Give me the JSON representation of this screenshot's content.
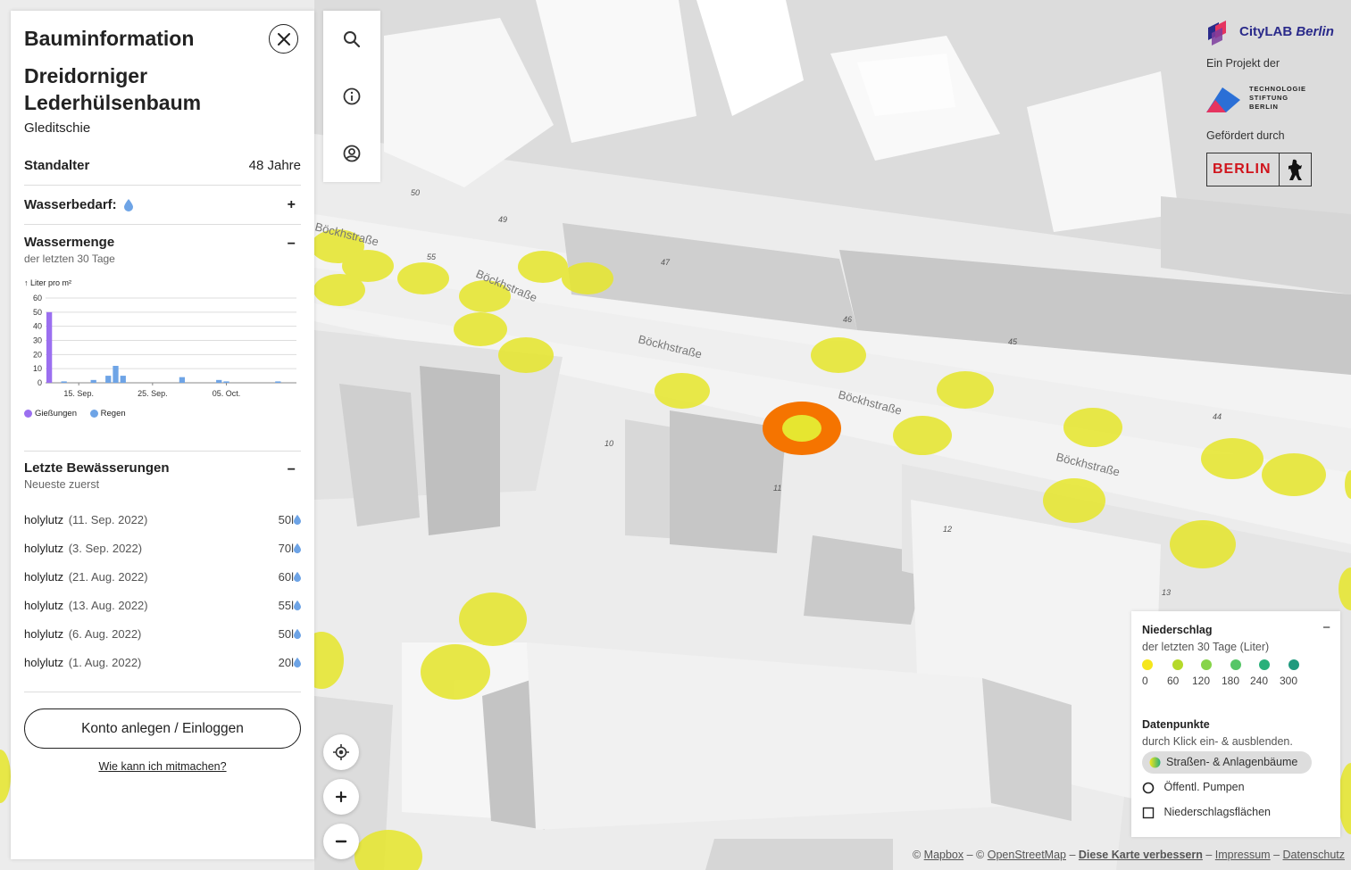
{
  "sidebar": {
    "title": "Bauminformation",
    "tree_name": "Dreidorniger Lederhülsenbaum",
    "tree_genus": "Gleditschie",
    "age_label": "Standalter",
    "age_value": "48 Jahre",
    "water_need_label": "Wasserbedarf:",
    "water_need_toggle": "+",
    "water_amount_label": "Wassermenge",
    "water_amount_sub": "der letzten 30 Tage",
    "water_amount_toggle": "−",
    "last_watering_label": "Letzte Bewässerungen",
    "last_watering_sub": "Neueste zuerst",
    "last_watering_toggle": "−",
    "waterings": [
      {
        "user": "holylutz",
        "date": "(11. Sep. 2022)",
        "amount": "50l"
      },
      {
        "user": "holylutz",
        "date": "(3. Sep. 2022)",
        "amount": "70l"
      },
      {
        "user": "holylutz",
        "date": "(21. Aug. 2022)",
        "amount": "60l"
      },
      {
        "user": "holylutz",
        "date": "(13. Aug. 2022)",
        "amount": "55l"
      },
      {
        "user": "holylutz",
        "date": "(6. Aug. 2022)",
        "amount": "50l"
      },
      {
        "user": "holylutz",
        "date": "(1. Aug. 2022)",
        "amount": "20l"
      }
    ],
    "login_button": "Konto anlegen / Einloggen",
    "help_link": "Wie kann ich mitmachen?"
  },
  "chart_data": {
    "type": "bar",
    "ylabel": "↑ Liter pro m²",
    "ylim": [
      0,
      60
    ],
    "yticks": [
      0,
      10,
      20,
      30,
      40,
      50,
      60
    ],
    "xtick_labels": [
      "15. Sep.",
      "25. Sep.",
      "05. Oct."
    ],
    "series": [
      {
        "name": "Gießungen",
        "color": "#9b6ff0",
        "values": [
          {
            "day": 0,
            "value": 50
          }
        ]
      },
      {
        "name": "Regen",
        "color": "#6ea4e6",
        "values": [
          {
            "day": 2,
            "value": 1
          },
          {
            "day": 6,
            "value": 2
          },
          {
            "day": 8,
            "value": 5
          },
          {
            "day": 9,
            "value": 12
          },
          {
            "day": 10,
            "value": 5
          },
          {
            "day": 18,
            "value": 4
          },
          {
            "day": 23,
            "value": 2
          },
          {
            "day": 24,
            "value": 1
          },
          {
            "day": 31,
            "value": 1
          }
        ]
      }
    ]
  },
  "map": {
    "street_labels": [
      "Böckhstraße",
      "Böckhstraße",
      "Böckhstraße",
      "Böckhstraße",
      "Böckhstraße"
    ],
    "house_numbers": [
      "50",
      "49",
      "55",
      "47",
      "46",
      "45",
      "44",
      "10",
      "11",
      "12",
      "13"
    ],
    "selected_tree_color": "#f57400",
    "tree_color": "#e6e630"
  },
  "logos": {
    "citylab_name": "CityLAB",
    "citylab_city": "Berlin",
    "project_of": "Ein Projekt der",
    "tsb_lines": [
      "TECHNOLOGIE",
      "STIFTUNG",
      "BERLIN"
    ],
    "funded_by": "Gefördert durch",
    "berlin": "BERLIN"
  },
  "legend": {
    "title": "Niederschlag",
    "subtitle": "der letzten 30 Tage (Liter)",
    "collapse": "−",
    "scale": [
      {
        "label": "0",
        "color": "#f5e61b"
      },
      {
        "label": "60",
        "color": "#b5d92a"
      },
      {
        "label": "120",
        "color": "#86d449"
      },
      {
        "label": "180",
        "color": "#56c667"
      },
      {
        "label": "240",
        "color": "#29b07a"
      },
      {
        "label": "300",
        "color": "#1f9a7e"
      }
    ],
    "datapoints_title": "Datenpunkte",
    "datapoints_sub": "durch Klick ein- & ausblenden.",
    "opt_trees": "Straßen- & Anlagenbäume",
    "opt_pumps": "Öffentl. Pumpen",
    "opt_rain": "Niederschlagsflächen"
  },
  "attribution": {
    "mapbox": "Mapbox",
    "osm": "OpenStreetMap",
    "improve": "Diese Karte verbessern",
    "impressum": "Impressum",
    "datenschutz": "Datenschutz"
  }
}
